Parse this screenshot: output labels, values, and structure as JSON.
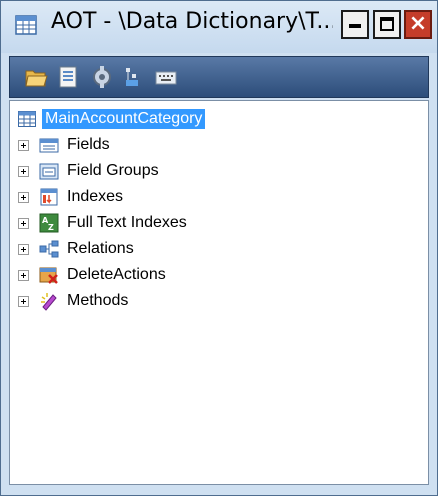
{
  "window": {
    "title": "AOT - \\Data Dictionary\\T...",
    "minimize_glyph": "",
    "maximize_glyph": "",
    "close_glyph": "×"
  },
  "toolbar": {
    "buttons": [
      {
        "name": "open-icon"
      },
      {
        "name": "properties-icon"
      },
      {
        "name": "compile-icon"
      },
      {
        "name": "find-icon"
      },
      {
        "name": "keyboard-icon"
      }
    ]
  },
  "tree": {
    "root": {
      "label": "MainAccountCategory",
      "icon": "table-icon",
      "selected": true
    },
    "nodes": [
      {
        "label": "Fields",
        "icon": "fields-icon"
      },
      {
        "label": "Field Groups",
        "icon": "field-groups-icon"
      },
      {
        "label": "Indexes",
        "icon": "indexes-icon"
      },
      {
        "label": "Full Text Indexes",
        "icon": "full-text-indexes-icon"
      },
      {
        "label": "Relations",
        "icon": "relations-icon"
      },
      {
        "label": "DeleteActions",
        "icon": "delete-actions-icon"
      },
      {
        "label": "Methods",
        "icon": "methods-icon"
      }
    ]
  },
  "colors": {
    "selection": "#3399ff",
    "toolbar": "#3f5f8c",
    "close_button": "#c53d2a",
    "frame": "#cfe0f1"
  }
}
